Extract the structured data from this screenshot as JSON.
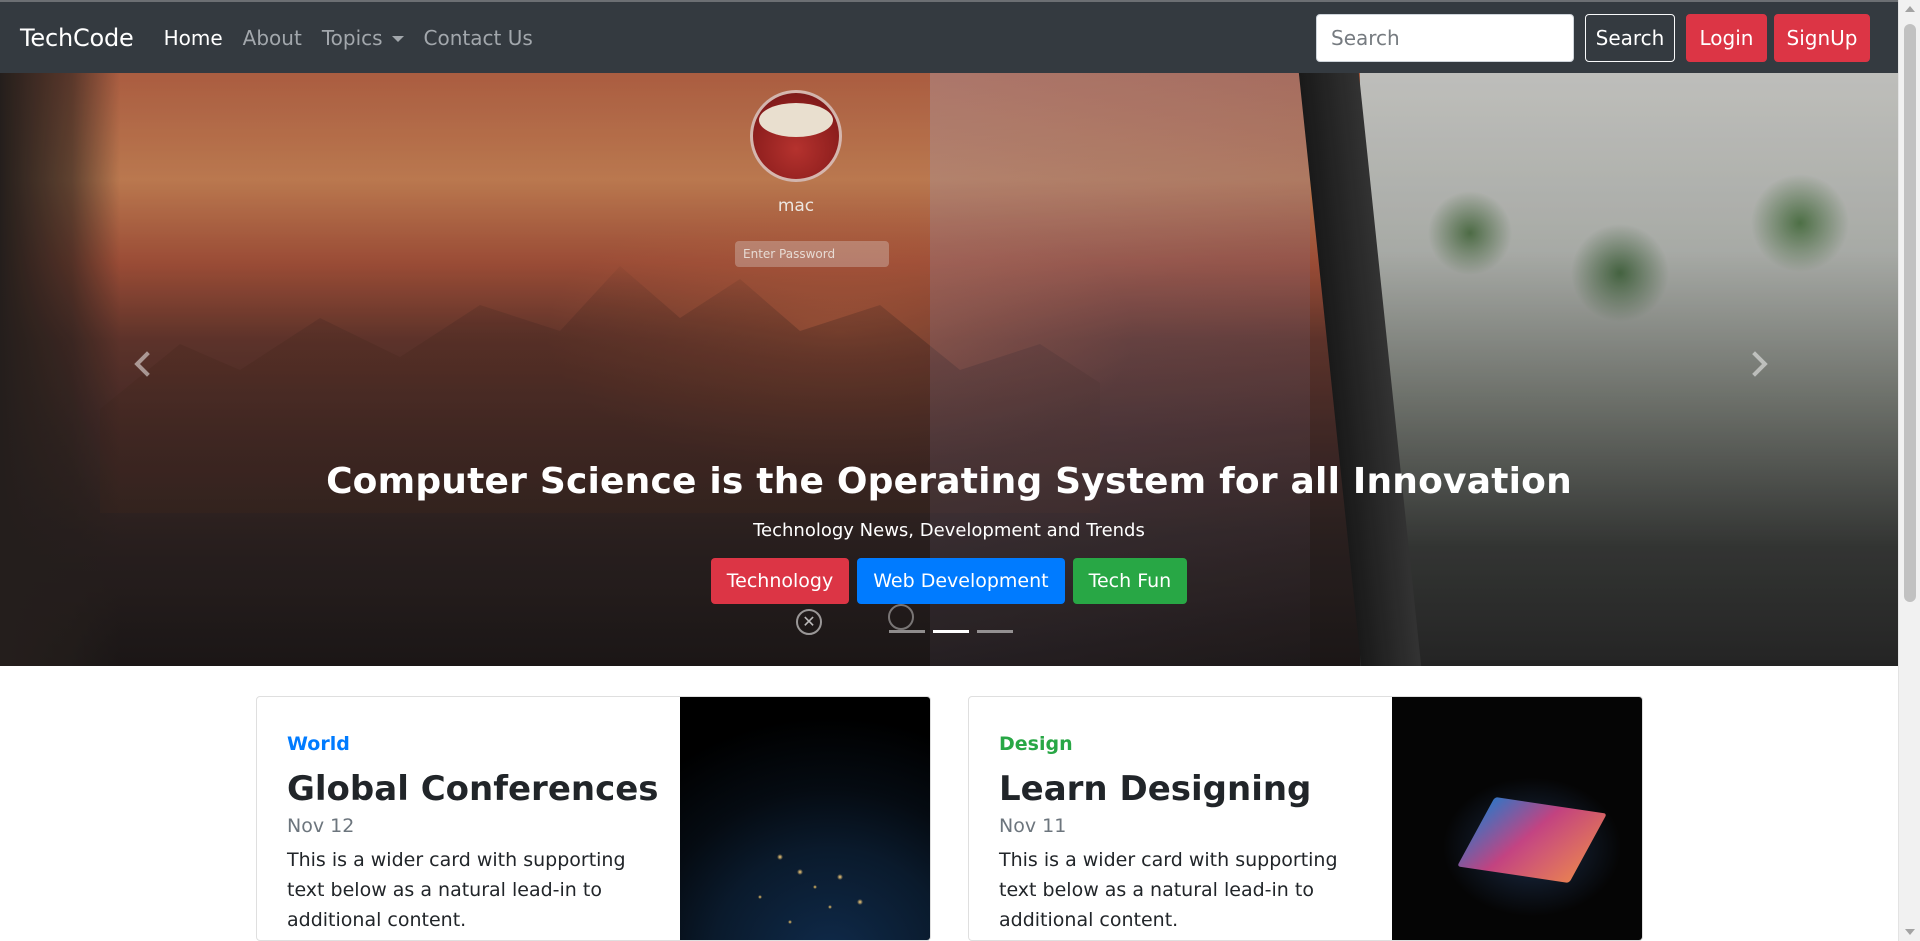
{
  "navbar": {
    "brand": "TechCode",
    "links": [
      {
        "label": "Home",
        "active": true
      },
      {
        "label": "About",
        "active": false
      },
      {
        "label": "Topics",
        "active": false,
        "dropdown": true
      },
      {
        "label": "Contact Us",
        "active": false
      }
    ],
    "search_placeholder": "Search",
    "search_button": "Search",
    "login_button": "Login",
    "signup_button": "SignUp"
  },
  "hero": {
    "screen_user": "mac",
    "screen_password_placeholder": "Enter Password",
    "title": "Computer Science is the Operating System for all Innovation",
    "subtitle": "Technology News, Development and Trends",
    "buttons": [
      {
        "label": "Technology",
        "color": "#dc3545"
      },
      {
        "label": "Web Development",
        "color": "#007bff"
      },
      {
        "label": "Tech Fun",
        "color": "#28a745"
      }
    ],
    "indicators": {
      "count": 3,
      "active_index": 1
    }
  },
  "cards": [
    {
      "category": "World",
      "category_color": "#007bff",
      "title": "Global Conferences",
      "date": "Nov 12",
      "text": "This is a wider card with supporting text below as a natural lead-in to additional content.",
      "image": "earth-night-image"
    },
    {
      "category": "Design",
      "category_color": "#28a745",
      "title": "Learn Designing",
      "date": "Nov 11",
      "text": "This is a wider card with supporting text below as a natural lead-in to additional content.",
      "image": "laptop-image"
    }
  ],
  "colors": {
    "navbar_bg": "#343a40",
    "danger": "#dc3545",
    "primary": "#007bff",
    "success": "#28a745"
  }
}
